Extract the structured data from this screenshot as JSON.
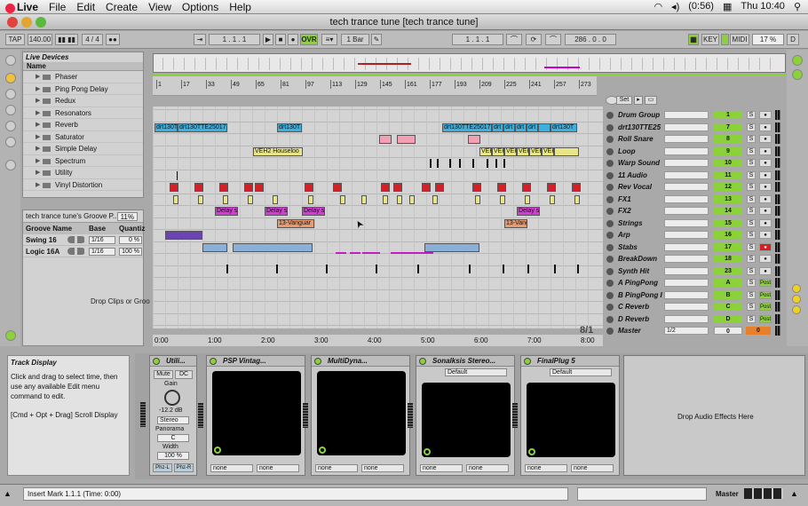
{
  "menubar": {
    "app": "Live",
    "items": [
      "File",
      "Edit",
      "Create",
      "View",
      "Options",
      "Help"
    ],
    "battery": "(0:56)",
    "clock": "Thu 10:40"
  },
  "window": {
    "title": "tech trance tune  [tech trance tune]"
  },
  "transport": {
    "tap": "TAP",
    "tempo": "140.00",
    "signature": "4 / 4",
    "position": "1 .   1 .   1",
    "ovr": "OVR",
    "quantize": "1 Bar",
    "loop_start": "1 .   1 .   1",
    "loop_length": "286 .   0 .   0",
    "key": "KEY",
    "midi": "MIDI",
    "cpu": "17 %",
    "d": "D"
  },
  "browser": {
    "title": "Live Devices",
    "column": "Name",
    "items": [
      "Phaser",
      "Ping Pong Delay",
      "Redux",
      "Resonators",
      "Reverb",
      "Saturator",
      "Simple Delay",
      "Spectrum",
      "Utility",
      "Vinyl Distortion"
    ]
  },
  "groove": {
    "title": "tech trance tune's Groove P...",
    "amount": "11%",
    "cols": [
      "Groove Name",
      "Base",
      "Quantiz"
    ],
    "rows": [
      {
        "name": "Swing 16",
        "base": "1/16",
        "q": "0 %"
      },
      {
        "name": "Logic 16A",
        "base": "1/16",
        "q": "100 %"
      }
    ],
    "drop": "Drop Clips or Groo"
  },
  "ruler": {
    "bars": [
      "1",
      "17",
      "33",
      "49",
      "65",
      "81",
      "97",
      "113",
      "129",
      "145",
      "161",
      "177",
      "193",
      "209",
      "225",
      "241",
      "257",
      "273"
    ]
  },
  "times": [
    "0:00",
    "1:00",
    "2:00",
    "3:00",
    "4:00",
    "5:00",
    "6:00",
    "7:00",
    "8:00"
  ],
  "sig_label": "8/1",
  "set_label": "Set",
  "clips": {
    "drt1": "drt130T",
    "drt2": "drt130TTE25017",
    "drt3": "drt130T",
    "drt4": "drt130TTE25017",
    "drt5": "drt",
    "drt6": "drt",
    "drt7": "drt",
    "drt8": "drt",
    "drt9": "drt130T",
    "veh1": "VEH2 Houseloo",
    "veh2": "VEH",
    "veh3": "VEH",
    "veh4": "VEH",
    "veh5": "VEH",
    "veh6": "VEH",
    "veh7": "VEH2 H",
    "delay1": "Delay s",
    "delay2": "Delay s",
    "delay3": "Delay s",
    "delay4": "Delay s",
    "vang1": "13-Vanguar",
    "vang2": "13-Vang"
  },
  "tracks": [
    {
      "name": "Drum Group",
      "num": "1",
      "r": "●"
    },
    {
      "name": "drt130TTE25",
      "num": "7",
      "r": "●"
    },
    {
      "name": "Roll Snare",
      "num": "8",
      "r": "●"
    },
    {
      "name": "Loop",
      "num": "9",
      "r": "●"
    },
    {
      "name": "Warp Sound",
      "num": "10",
      "r": "●"
    },
    {
      "name": "11 Audio",
      "num": "11",
      "r": "●"
    },
    {
      "name": "Rev Vocal",
      "num": "12",
      "r": "●"
    },
    {
      "name": "FX1",
      "num": "13",
      "r": "●"
    },
    {
      "name": "FX2",
      "num": "14",
      "r": "●"
    },
    {
      "name": "Strings",
      "num": "15",
      "r": "●"
    },
    {
      "name": "Arp",
      "num": "16",
      "r": "●"
    },
    {
      "name": "Stabs",
      "num": "17",
      "r": "●"
    },
    {
      "name": "BreakDown",
      "num": "18",
      "r": "●"
    },
    {
      "name": "Synth Hit",
      "num": "23",
      "r": "●"
    },
    {
      "name": "A PingPong",
      "num": "A",
      "r": "Post"
    },
    {
      "name": "B PingPong I",
      "num": "B",
      "r": "Post"
    },
    {
      "name": "C Reverb",
      "num": "C",
      "r": "Post"
    },
    {
      "name": "D Reverb",
      "num": "D",
      "r": "Post"
    }
  ],
  "master": {
    "name": "Master",
    "sel": "1/2",
    "vol": "0",
    "pan": "0"
  },
  "info": {
    "title": "Track Display",
    "body": "Click and drag to select time, then use any available Edit menu command to edit.",
    "shortcut": "[Cmd + Opt + Drag] Scroll Display"
  },
  "devices": {
    "utility": {
      "name": "Utili...",
      "mute": "Mute",
      "dc": "DC",
      "gain_label": "Gain",
      "gain": "-12.2 dB",
      "mode": "Stereo",
      "panorama_label": "Panorama",
      "panorama": "C",
      "width_label": "Width",
      "width": "100 %",
      "phzl": "Phz-L",
      "phzr": "Phz-R"
    },
    "plugs": [
      {
        "name": "PSP Vintag..."
      },
      {
        "name": "MultiDyna..."
      },
      {
        "name": "Sonalksis Stereo..."
      },
      {
        "name": "FinalPlug 5"
      }
    ],
    "preset": "Default",
    "none": "none",
    "drop": "Drop Audio Effects Here"
  },
  "status": {
    "text": "Insert Mark 1.1.1 (Time: 0:00)",
    "master": "Master"
  }
}
